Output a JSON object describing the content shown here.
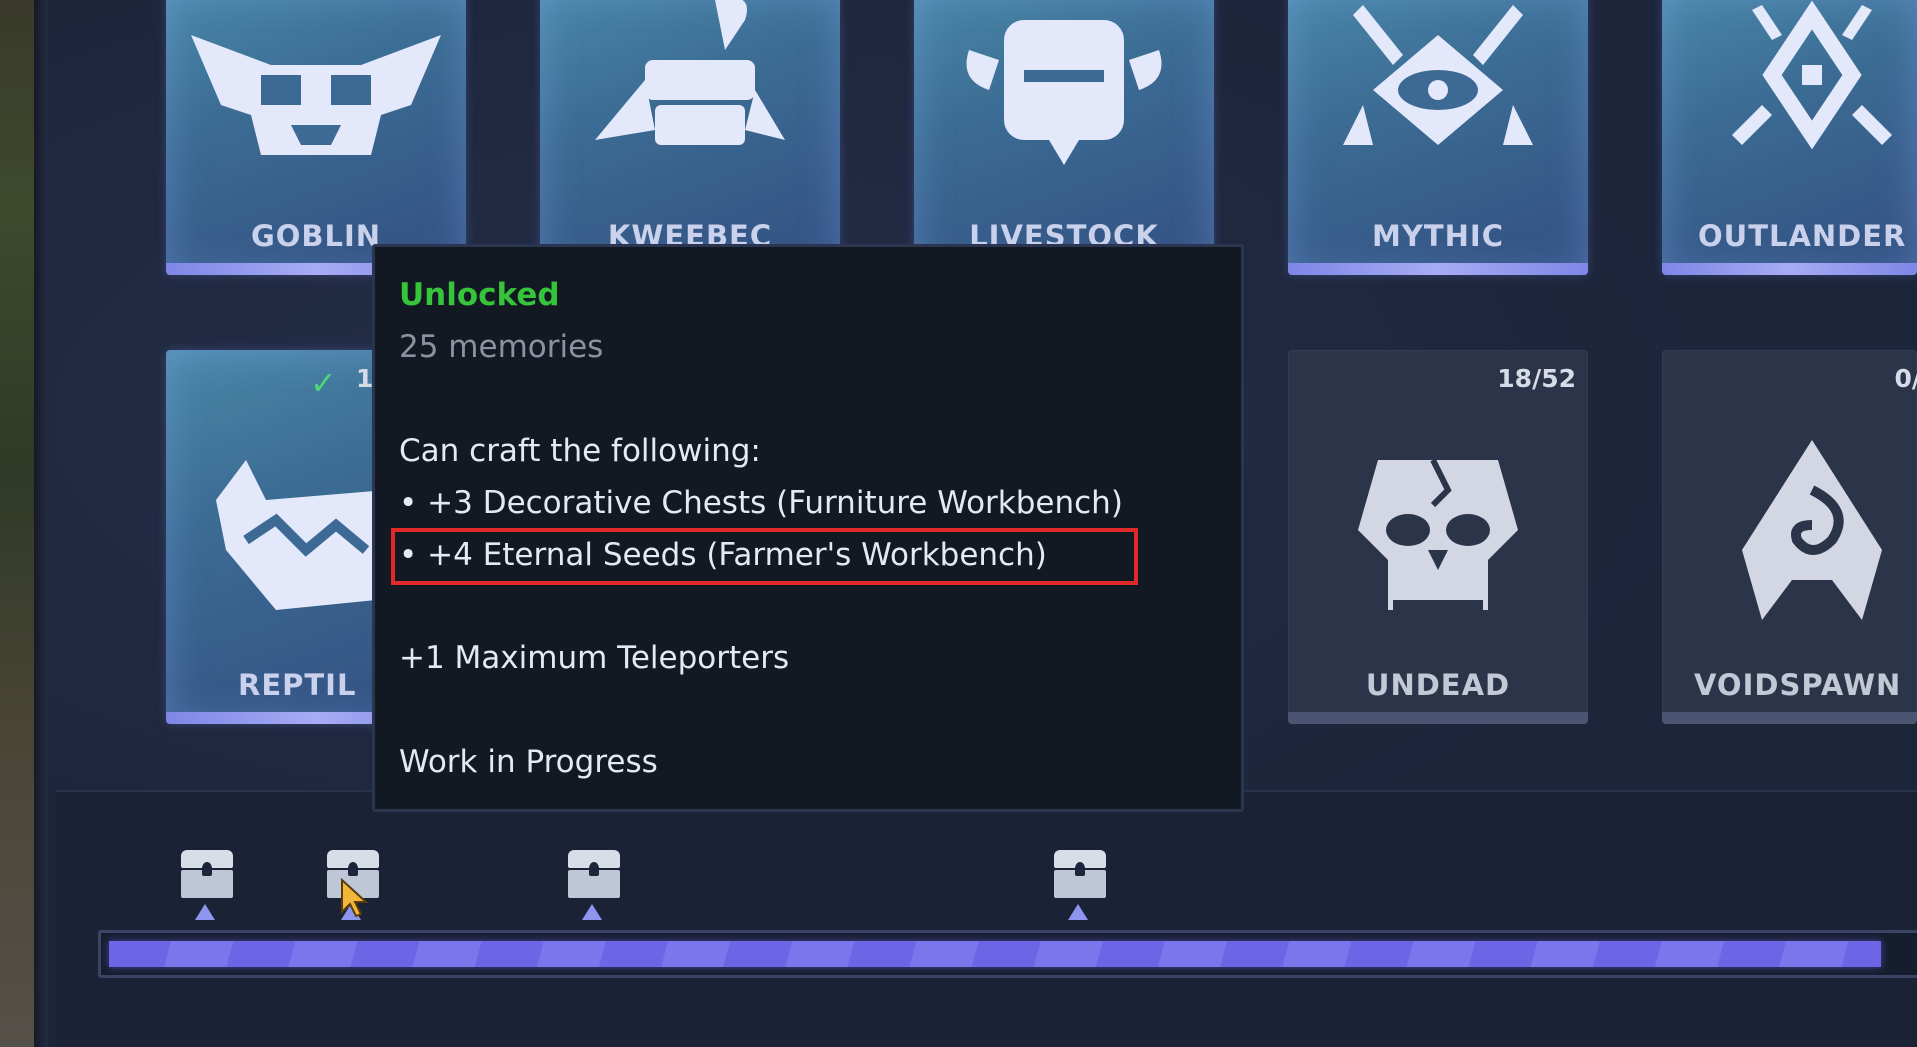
{
  "cards_row1": [
    {
      "label": "GOBLIN",
      "icon": "goblin-skull-icon"
    },
    {
      "label": "KWEEBEC",
      "icon": "kweebec-icon"
    },
    {
      "label": "LIVESTOCK",
      "icon": "livestock-icon"
    },
    {
      "label": "MYTHIC",
      "icon": "mythic-eye-icon"
    },
    {
      "label": "OUTLANDER",
      "icon": "outlander-icon"
    }
  ],
  "cards_row2": [
    {
      "label": "REPTIL",
      "icon": "reptile-icon",
      "count": "1"
    },
    {
      "label": "UNDEAD",
      "icon": "undead-skull-icon",
      "count": "18/52"
    },
    {
      "label": "VOIDSPAWN",
      "icon": "voidspawn-icon",
      "count": "0/"
    }
  ],
  "tooltip": {
    "status": "Unlocked",
    "memories": "25 memories",
    "craft_heading": "Can craft the following:",
    "craft_items": [
      "+3 Decorative Chests (Furniture Workbench)",
      "+4 Eternal Seeds (Farmer's Workbench)"
    ],
    "bonus": "+1 Maximum Teleporters",
    "note": "Work in Progress"
  },
  "progress": {
    "fill_fraction": 0.98
  },
  "colors": {
    "unlocked_text": "#35c43a",
    "highlight_border": "#e02a2a",
    "progress_fill": "#6c66e6"
  }
}
